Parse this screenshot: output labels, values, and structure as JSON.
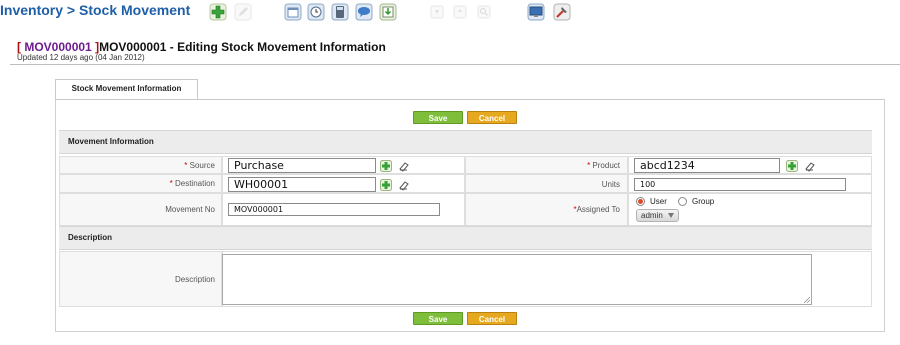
{
  "breadcrumb": {
    "module": "Inventory",
    "separator": ">",
    "page": "Stock Movement"
  },
  "toolbar": {
    "icons": [
      "add-icon",
      "edit-icon",
      "calendar-icon",
      "clock-icon",
      "calculator-icon",
      "chat-icon",
      "import-icon",
      "filter-icon",
      "sort-icon",
      "search-icon",
      "monitor-icon",
      "tools-icon"
    ]
  },
  "record": {
    "id": "[ MOV000001 ]",
    "id_open": "[ ",
    "id_num": "MOV000001",
    "id_close": " ]",
    "title": "MOV000001 - Editing Stock Movement Information",
    "updated": "Updated 12 days ago (04 Jan 2012)"
  },
  "tab": {
    "label": "Stock Movement Information"
  },
  "buttons": {
    "save": "Save",
    "cancel": "Cancel"
  },
  "sections": {
    "movement": "Movement Information",
    "description": "Description"
  },
  "fields": {
    "source": {
      "label": "Source",
      "required_mark": "*",
      "value": "Purchase"
    },
    "destination": {
      "label": "Destination",
      "required_mark": "*",
      "value": "WH00001"
    },
    "movement_no": {
      "label": "Movement No",
      "value": "MOV000001"
    },
    "product": {
      "label": "Product",
      "required_mark": "*",
      "value": "abcd1234"
    },
    "units": {
      "label": "Units",
      "value": "100"
    },
    "assigned_to": {
      "label": "Assigned To",
      "required_mark": "*",
      "options": [
        "User",
        "Group"
      ],
      "selected": "User",
      "select_value": "admin"
    },
    "description": {
      "label": "Description",
      "value": ""
    }
  },
  "colors": {
    "breadcrumb": "#1f5fa8",
    "save": "#7fbe3b",
    "cancel": "#e6a81e",
    "required": "#cc0000",
    "record_id": "#b01010"
  }
}
